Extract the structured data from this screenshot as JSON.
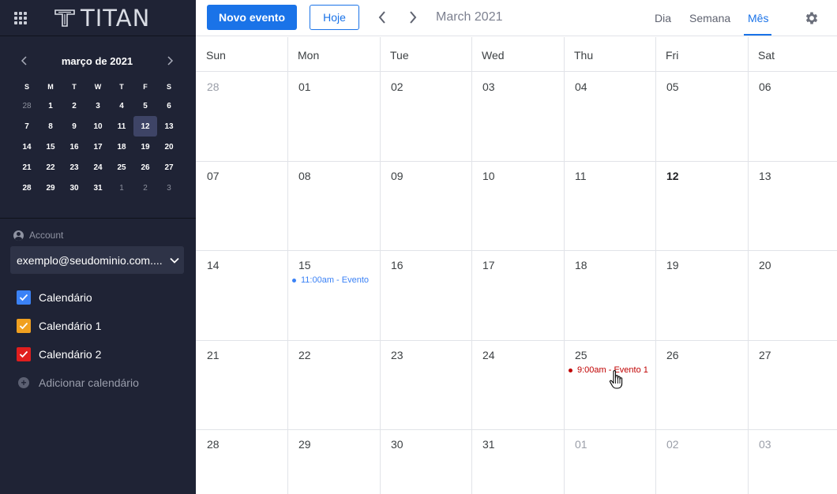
{
  "sidebar": {
    "logo_text": "TITAN",
    "mini_calendar": {
      "title": "março de 2021",
      "weekdays": [
        "S",
        "M",
        "T",
        "W",
        "T",
        "F",
        "S"
      ],
      "days": [
        {
          "d": "28",
          "other": true
        },
        {
          "d": "1"
        },
        {
          "d": "2"
        },
        {
          "d": "3"
        },
        {
          "d": "4"
        },
        {
          "d": "5"
        },
        {
          "d": "6"
        },
        {
          "d": "7"
        },
        {
          "d": "8"
        },
        {
          "d": "9"
        },
        {
          "d": "10"
        },
        {
          "d": "11"
        },
        {
          "d": "12",
          "today": true
        },
        {
          "d": "13"
        },
        {
          "d": "14"
        },
        {
          "d": "15"
        },
        {
          "d": "16"
        },
        {
          "d": "17"
        },
        {
          "d": "18"
        },
        {
          "d": "19"
        },
        {
          "d": "20"
        },
        {
          "d": "21"
        },
        {
          "d": "22"
        },
        {
          "d": "23"
        },
        {
          "d": "24"
        },
        {
          "d": "25"
        },
        {
          "d": "26"
        },
        {
          "d": "27"
        },
        {
          "d": "28"
        },
        {
          "d": "29"
        },
        {
          "d": "30"
        },
        {
          "d": "31"
        },
        {
          "d": "1",
          "other": true
        },
        {
          "d": "2",
          "other": true
        },
        {
          "d": "3",
          "other": true
        }
      ]
    },
    "account_label": "Account",
    "account_value": "exemplo@seudominio.com....",
    "calendars": [
      {
        "label": "Calendário",
        "color": "#3b82f6"
      },
      {
        "label": "Calendário 1",
        "color": "#f0a020"
      },
      {
        "label": "Calendário 2",
        "color": "#e01e1e"
      }
    ],
    "add_calendar": "Adicionar calendário"
  },
  "toolbar": {
    "new_event": "Novo evento",
    "today": "Hoje",
    "month_title": "March 2021",
    "views": {
      "day": "Dia",
      "week": "Semana",
      "month": "Mês"
    }
  },
  "month": {
    "weekdays": [
      "Sun",
      "Mon",
      "Tue",
      "Wed",
      "Thu",
      "Fri",
      "Sat"
    ],
    "weeks": [
      [
        {
          "d": "28",
          "other": true
        },
        {
          "d": "01"
        },
        {
          "d": "02"
        },
        {
          "d": "03"
        },
        {
          "d": "04"
        },
        {
          "d": "05"
        },
        {
          "d": "06"
        }
      ],
      [
        {
          "d": "07"
        },
        {
          "d": "08"
        },
        {
          "d": "09"
        },
        {
          "d": "10"
        },
        {
          "d": "11"
        },
        {
          "d": "12",
          "today": true
        },
        {
          "d": "13"
        }
      ],
      [
        {
          "d": "14"
        },
        {
          "d": "15"
        },
        {
          "d": "16"
        },
        {
          "d": "17"
        },
        {
          "d": "18"
        },
        {
          "d": "19"
        },
        {
          "d": "20"
        }
      ],
      [
        {
          "d": "21"
        },
        {
          "d": "22"
        },
        {
          "d": "23"
        },
        {
          "d": "24"
        },
        {
          "d": "25"
        },
        {
          "d": "26"
        },
        {
          "d": "27"
        }
      ],
      [
        {
          "d": "28"
        },
        {
          "d": "29"
        },
        {
          "d": "30"
        },
        {
          "d": "31"
        },
        {
          "d": "01",
          "other": true
        },
        {
          "d": "02",
          "other": true
        },
        {
          "d": "03",
          "other": true
        }
      ]
    ],
    "events": [
      {
        "week": 2,
        "day": 1,
        "label": "11:00am - Evento",
        "color": "#3b82f6"
      },
      {
        "week": 3,
        "day": 4,
        "label": "9:00am - Evento 1",
        "color": "#c00000"
      }
    ]
  }
}
